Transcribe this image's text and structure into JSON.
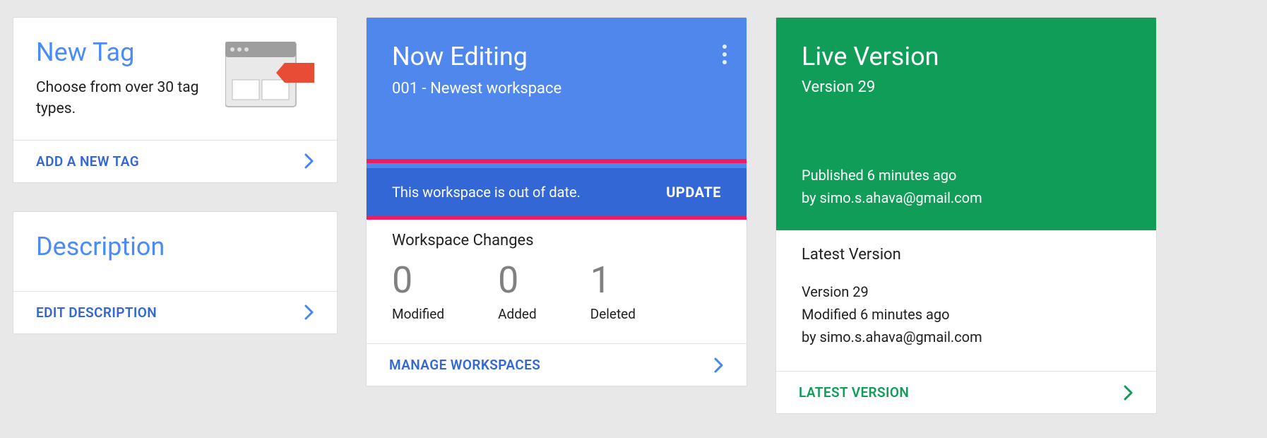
{
  "new_tag": {
    "title": "New Tag",
    "subtitle": "Choose from over 30 tag types.",
    "action": "ADD A NEW TAG"
  },
  "description": {
    "title": "Description",
    "action": "EDIT DESCRIPTION"
  },
  "editing": {
    "title": "Now Editing",
    "subtitle": "001 - Newest workspace",
    "notice": "This workspace is out of date.",
    "notice_action": "UPDATE",
    "changes_heading": "Workspace Changes",
    "stats": {
      "modified_value": "0",
      "modified_label": "Modified",
      "added_value": "0",
      "added_label": "Added",
      "deleted_value": "1",
      "deleted_label": "Deleted"
    },
    "action": "MANAGE WORKSPACES"
  },
  "live": {
    "title": "Live Version",
    "version": "Version 29",
    "published_line": "Published 6 minutes ago",
    "by_line": "by simo.s.ahava@gmail.com",
    "latest_heading": "Latest Version",
    "latest_version": "Version 29",
    "latest_modified": "Modified 6 minutes ago",
    "latest_by": "by simo.s.ahava@gmail.com",
    "action": "LATEST VERSION"
  }
}
